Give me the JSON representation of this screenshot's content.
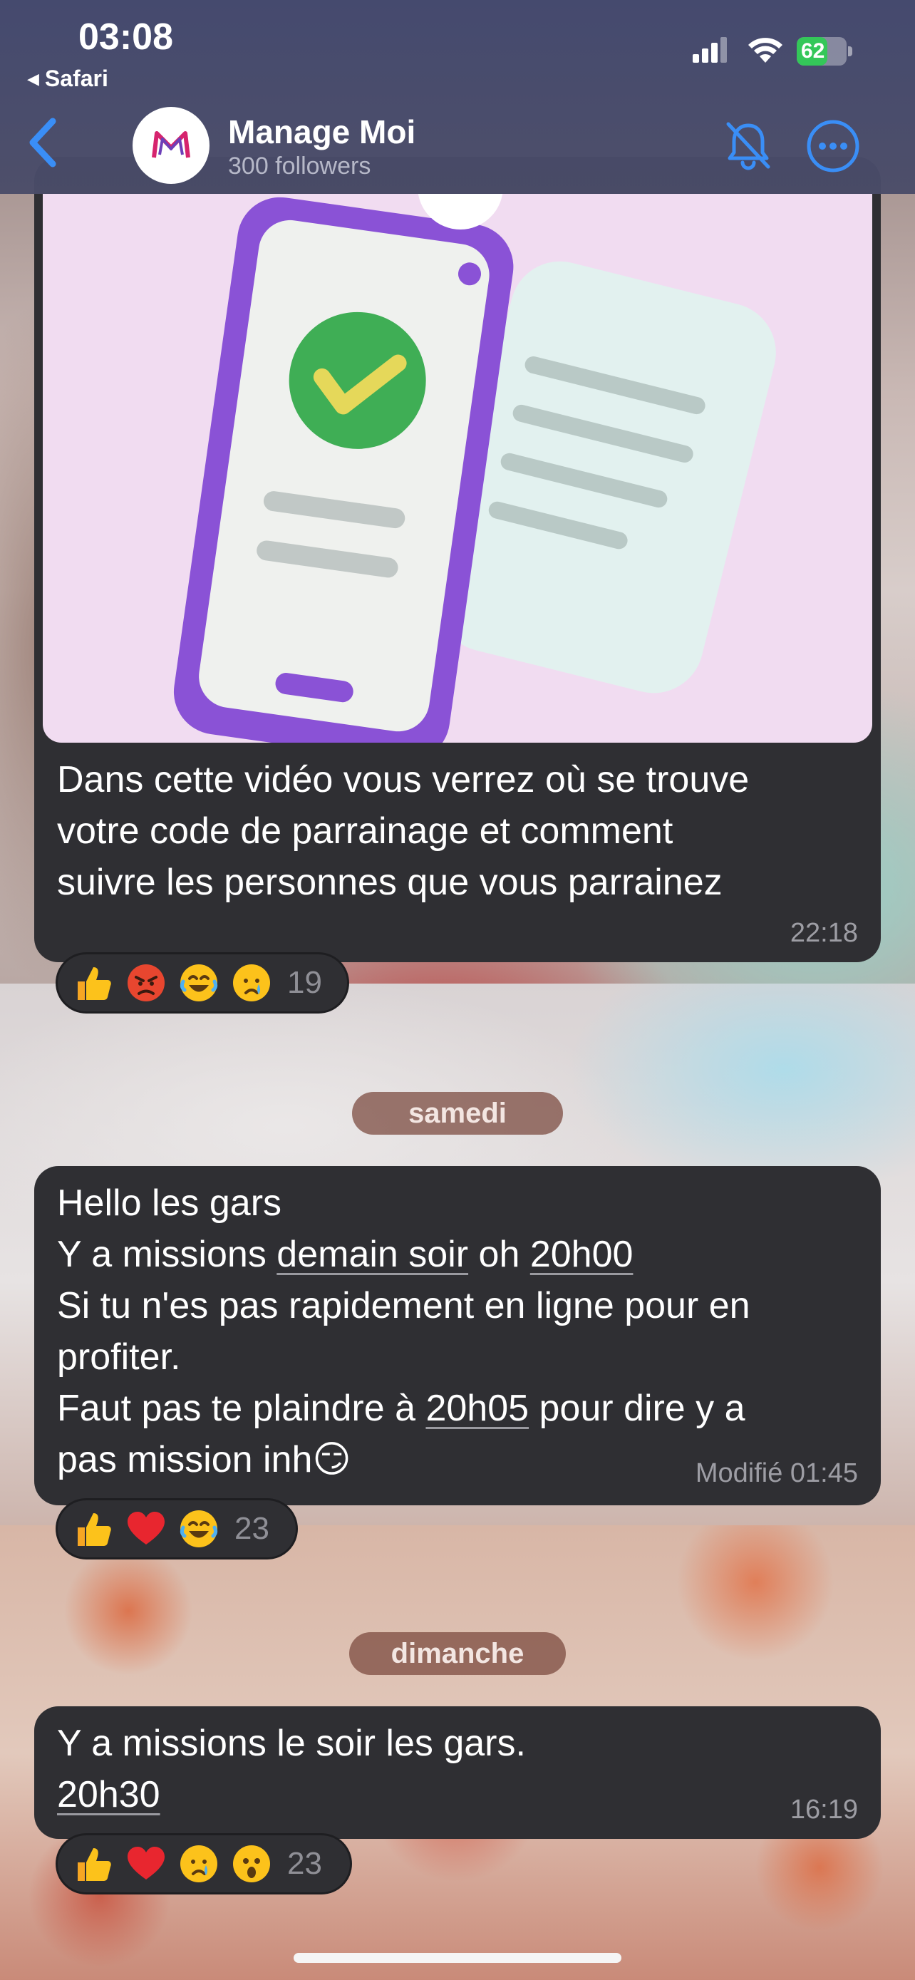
{
  "status_bar": {
    "time": "03:08",
    "back_app": "Safari",
    "battery_percent": "62",
    "battery_level": 0.62
  },
  "header": {
    "channel_name": "Manage Moi",
    "subtitle": "300 followers",
    "back_icon": "chevron-left-icon",
    "mute_icon": "bell-slash-icon",
    "more_icon": "ellipsis-circle-icon",
    "accent_color": "#3a8ef6"
  },
  "messages": [
    {
      "text": "Dans cette vidéo vous verrez où se trouve votre code de parrainage et comment suivre les personnes que vous parrainez",
      "lines": [
        "Dans cette vidéo vous verrez où se trouve",
        "votre code de parrainage et comment",
        "suivre les personnes que vous parrainez"
      ],
      "time": "22:18",
      "reactions": {
        "emojis": [
          "thumbs-up",
          "angry-face",
          "joy-face",
          "crying-face"
        ],
        "count": "19"
      }
    },
    {
      "date_separator": "samedi",
      "lines": [
        {
          "parts": [
            "Hello les gars"
          ]
        },
        {
          "parts": [
            "Y a missions ",
            "demain soir",
            " oh ",
            "20h00"
          ]
        },
        {
          "parts": [
            "Si tu n'es pas rapidement en ligne pour en"
          ]
        },
        {
          "parts": [
            "profiter."
          ]
        },
        {
          "parts": [
            "Faut pas te plaindre à ",
            "20h05",
            " pour dire y a"
          ]
        },
        {
          "parts": [
            "pas mission inh",
            "😏"
          ]
        }
      ],
      "time": "Modifié 01:45",
      "reactions": {
        "emojis": [
          "thumbs-up",
          "red-heart",
          "joy-face"
        ],
        "count": "23"
      }
    },
    {
      "date_separator": "dimanche",
      "lines": [
        {
          "parts": [
            "Y a missions le soir les gars."
          ]
        },
        {
          "parts": [
            "20h30"
          ]
        }
      ],
      "time": "16:19",
      "reactions": {
        "emojis": [
          "thumbs-up",
          "red-heart",
          "crying-face",
          "astonished-face"
        ],
        "count": "23"
      }
    }
  ],
  "colors": {
    "bubble": "#2f2f33",
    "meta_text": "#9d9da4",
    "date_pill": "#8a4e44"
  }
}
